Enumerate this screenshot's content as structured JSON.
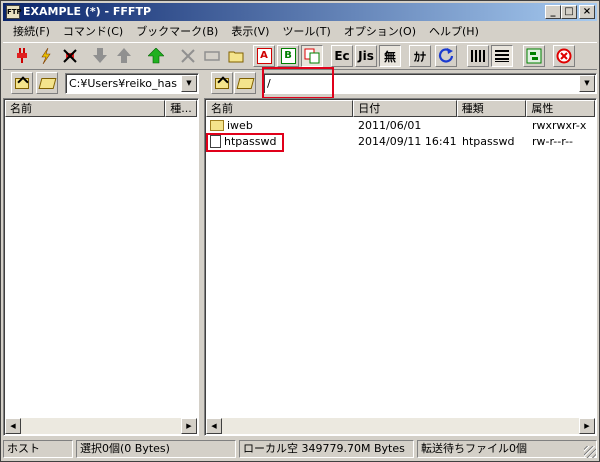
{
  "window": {
    "title": "EXAMPLE (*) - FFFTP",
    "app_icon": "FFFTP"
  },
  "menu": [
    "接続(F)",
    "コマンド(C)",
    "ブックマーク(B)",
    "表示(V)",
    "ツール(T)",
    "オプション(O)",
    "ヘルプ(H)"
  ],
  "toolbar": {
    "btn_a": "A",
    "btn_b": "B",
    "btn_ec": "Ec",
    "btn_jis": "Jis",
    "btn_mu": "無",
    "btn_kana": "ｶﾅ"
  },
  "local": {
    "path": "C:¥Users¥reiko_has",
    "columns": [
      "名前",
      "種..."
    ],
    "files": []
  },
  "remote": {
    "path": "/",
    "columns": [
      "名前",
      "日付",
      "種類",
      "属性"
    ],
    "files": [
      {
        "name": "iweb",
        "date": "2011/06/01",
        "type": "",
        "attr": "rwxrwxr-x",
        "icon": "folder-icon"
      },
      {
        "name": "htpasswd",
        "date": "2014/09/11 16:41",
        "type": "htpasswd",
        "attr": "rw-r--r--",
        "icon": "file-icon"
      }
    ]
  },
  "status": {
    "host": "ホスト",
    "selection": "選択0個(0 Bytes)",
    "local_free": "ローカル空 349779.70M Bytes",
    "queue": "転送待ちファイル0個"
  },
  "colors": {
    "highlight": "#e0001a",
    "title_start": "#0a246a",
    "title_end": "#a6caf0"
  }
}
